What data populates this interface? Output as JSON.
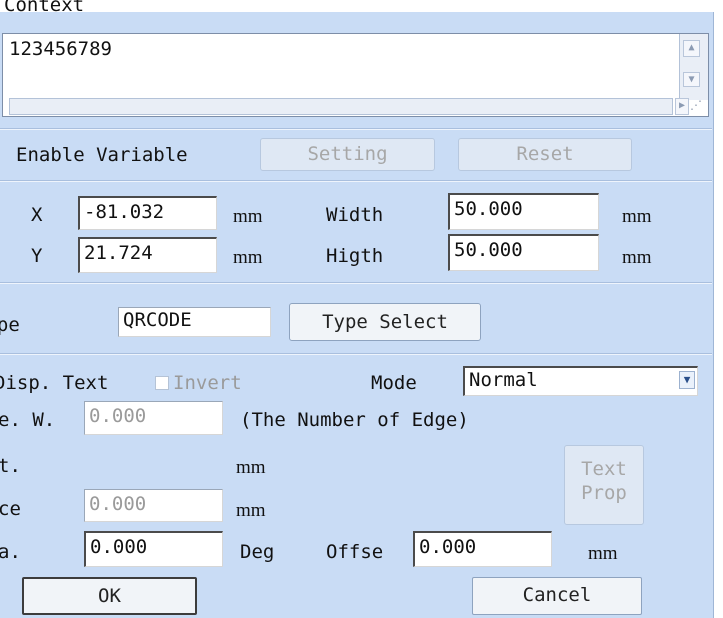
{
  "context": {
    "label": "Context",
    "text_value": "123456789"
  },
  "variable": {
    "enable_label": "Enable Variable",
    "setting_button": "Setting",
    "reset_button": "Reset"
  },
  "position": {
    "x_label": "X",
    "x_value": "-81.032",
    "x_unit": "mm",
    "y_label": "Y",
    "y_value": "21.724",
    "y_unit": "mm",
    "width_label": "Width",
    "width_value": "50.000",
    "width_unit": "mm",
    "height_label": "Higth",
    "height_value": "50.000",
    "height_unit": "mm"
  },
  "barcode_type": {
    "label": "Type",
    "value": "QRCODE",
    "select_button": "Type Select"
  },
  "options": {
    "disp_text_label": "Disp. Text",
    "invert_label": "Invert",
    "mode_label": "Mode",
    "mode_value": "Normal",
    "edge_label": "e. W.",
    "edge_value": "0.000",
    "edge_note": "(The Number of Edge)",
    "height_label": "t.",
    "height_unit": "mm",
    "space_label": "ce",
    "space_value": "0.000",
    "space_unit": "mm",
    "text_prop_line1": "Text",
    "text_prop_line2": "Prop",
    "angle_label": "a.",
    "angle_value": "0.000",
    "angle_unit": "Deg",
    "offset_label": "Offse",
    "offset_value": "0.000",
    "offset_unit": "mm"
  },
  "footer": {
    "ok_button": "OK",
    "cancel_button": "Cancel"
  },
  "icons": {
    "scroll_up": "chevron-up-icon",
    "scroll_down": "chevron-down-icon",
    "scroll_right": "chevron-right-icon",
    "resize_grip": "resize-grip-icon",
    "dropdown": "chevron-down-icon"
  },
  "colors": {
    "panel_bg": "#c9dcf5",
    "field_bg": "#ffffff",
    "button_bg": "#f1f4f8"
  }
}
